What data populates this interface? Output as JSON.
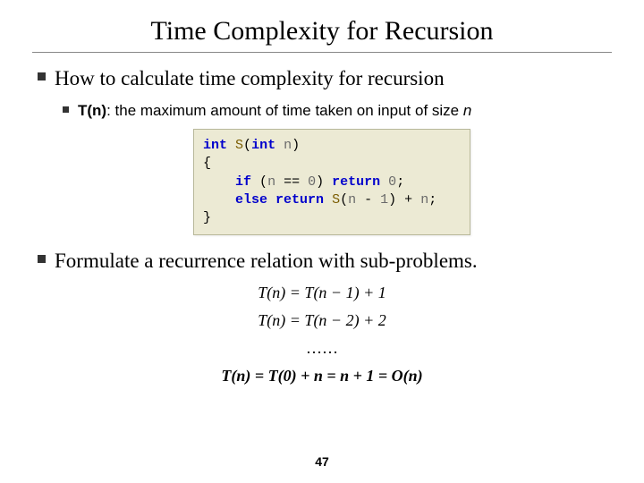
{
  "title": "Time Complexity for Recursion",
  "bullet1": "How to calculate time complexity for recursion",
  "bullet2_prefix": "T(n)",
  "bullet2_mid": ": the maximum amount of time taken on input of size ",
  "bullet2_n": "n",
  "bullet3": "Formulate a recurrence relation with sub-problems.",
  "code": {
    "kw_int1": "int",
    "fn1": "S",
    "lp1": "(",
    "kw_int2": "int",
    "n1": "n",
    "rp1": ")",
    "lbrace": "{",
    "kw_if": "if",
    "lp2": "(",
    "n2": "n",
    "eq": " == ",
    "zero": "0",
    "rp2": ")",
    "kw_return1": "return",
    "zero2": "0",
    "semi1": ";",
    "kw_else": "else",
    "kw_return2": "return",
    "fn2": "S",
    "lp3": "(",
    "n3": "n",
    "minus": " - ",
    "one": "1",
    "rp3": ")",
    "plus": " + ",
    "n4": "n",
    "semi2": ";",
    "rbrace": "}"
  },
  "eq1_a": "T(n) = T(n − 1) + 1",
  "eq2_a": "T(n) = T(n − 2) + 2",
  "dots": "……",
  "eq3_lhs": "T(n) = T(0) + n = n + 1 = O(n)",
  "pagenum": "47"
}
